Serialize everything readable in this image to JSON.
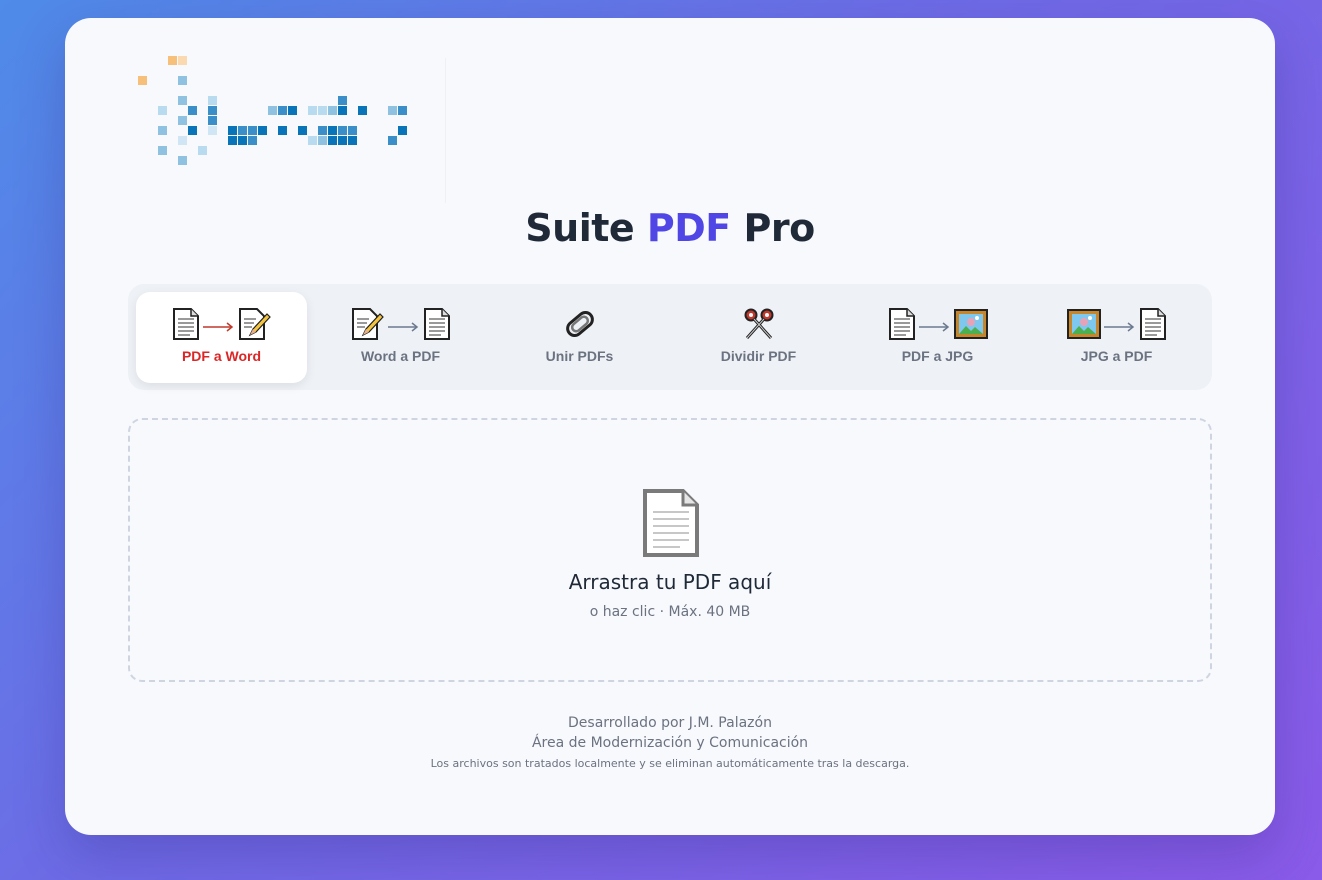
{
  "app": {
    "title_prefix": "Suite ",
    "title_accent": "PDF",
    "title_suffix": " Pro"
  },
  "colors": {
    "accent": "#4f46e5",
    "active_tab_label": "#dc2626",
    "text_dark": "#1f2937",
    "text_muted": "#6b7280"
  },
  "tabs": [
    {
      "label": "PDF a Word",
      "icons": [
        "page-icon",
        "arrow-right-icon",
        "memo-icon"
      ],
      "active": true
    },
    {
      "label": "Word a PDF",
      "icons": [
        "memo-icon",
        "arrow-right-icon",
        "page-icon"
      ],
      "active": false
    },
    {
      "label": "Unir PDFs",
      "icons": [
        "paperclip-icon"
      ],
      "active": false
    },
    {
      "label": "Dividir PDF",
      "icons": [
        "scissors-icon"
      ],
      "active": false
    },
    {
      "label": "PDF a JPG",
      "icons": [
        "page-icon",
        "arrow-right-icon",
        "framed-picture-icon"
      ],
      "active": false
    },
    {
      "label": "JPG a PDF",
      "icons": [
        "framed-picture-icon",
        "arrow-right-icon",
        "page-icon"
      ],
      "active": false
    }
  ],
  "dropzone": {
    "icon": "page-icon",
    "title": "Arrastra tu PDF aquí",
    "subtitle": "o haz clic · Máx. 40 MB"
  },
  "footer": {
    "line1": "Desarrollado por J.M. Palazón",
    "line2": "Área de Modernización y Comunicación",
    "line3": "Los archivos son tratados localmente y se eliminan automáticamente tras la descarga."
  }
}
